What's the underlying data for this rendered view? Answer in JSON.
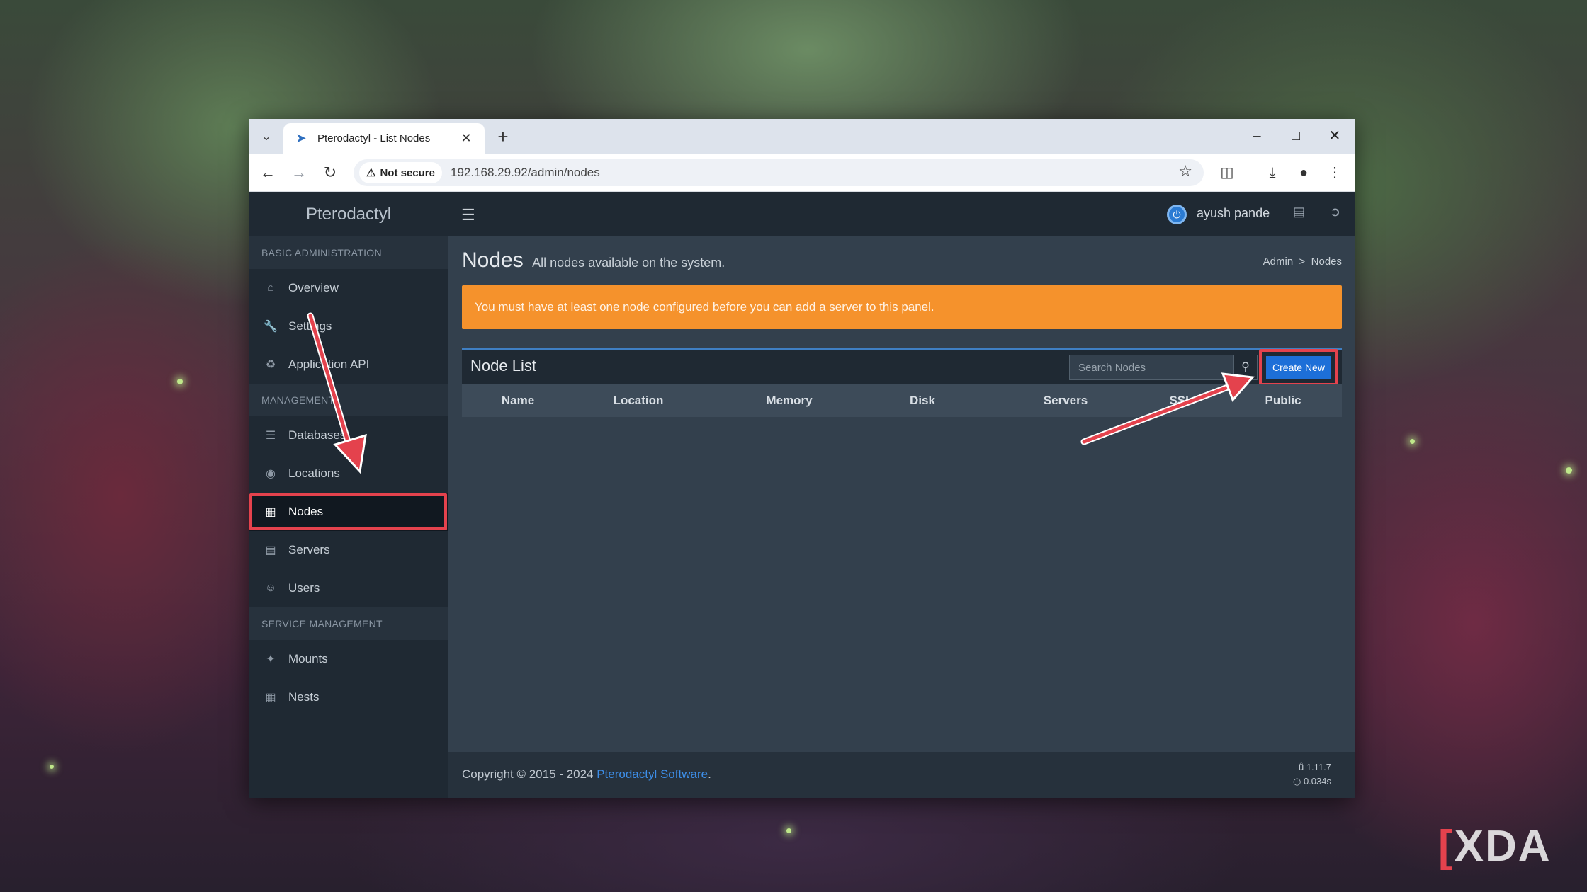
{
  "browser": {
    "tab_title": "Pterodactyl - List Nodes",
    "security_label": "Not secure",
    "url": "192.168.29.92/admin/nodes"
  },
  "app": {
    "logo": "Pterodactyl",
    "user_name": "ayush pande"
  },
  "sidebar": {
    "sections": [
      {
        "header": "BASIC ADMINISTRATION",
        "items": [
          {
            "label": "Overview",
            "icon": "home-icon"
          },
          {
            "label": "Settings",
            "icon": "wrench-icon"
          },
          {
            "label": "Application API",
            "icon": "gamepad-icon"
          }
        ]
      },
      {
        "header": "MANAGEMENT",
        "items": [
          {
            "label": "Databases",
            "icon": "database-icon"
          },
          {
            "label": "Locations",
            "icon": "globe-icon"
          },
          {
            "label": "Nodes",
            "icon": "sitemap-icon",
            "active": true
          },
          {
            "label": "Servers",
            "icon": "server-icon"
          },
          {
            "label": "Users",
            "icon": "users-icon"
          }
        ]
      },
      {
        "header": "SERVICE MANAGEMENT",
        "items": [
          {
            "label": "Mounts",
            "icon": "magic-icon"
          },
          {
            "label": "Nests",
            "icon": "th-large-icon"
          }
        ]
      }
    ]
  },
  "page": {
    "title": "Nodes",
    "subtitle": "All nodes available on the system.",
    "breadcrumb": {
      "root": "Admin",
      "separator": ">",
      "current": "Nodes"
    },
    "alert": "You must have at least one node configured before you can add a server to this panel."
  },
  "node_list": {
    "title": "Node List",
    "search_placeholder": "Search Nodes",
    "create_label": "Create New",
    "columns": [
      "Name",
      "Location",
      "Memory",
      "Disk",
      "Servers",
      "SSL",
      "Public"
    ],
    "rows": []
  },
  "footer": {
    "copyright_prefix": "Copyright © 2015 - 2024 ",
    "link_text": "Pterodactyl Software",
    "suffix": ".",
    "version": "1.11.7",
    "render_time": "0.034s"
  },
  "watermark": "XDA",
  "colors": {
    "alert": "#f5922c",
    "primary_button": "#1d6fd8",
    "highlight": "#e4424d",
    "sidebar": "#1f2933",
    "content": "#33404d"
  }
}
